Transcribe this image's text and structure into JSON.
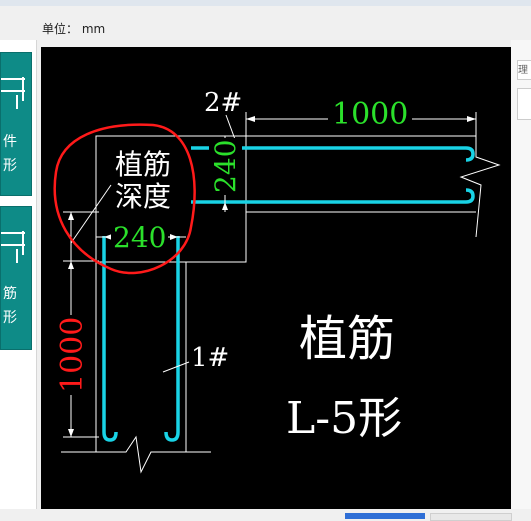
{
  "header": {
    "unit_label": "单位：  mm"
  },
  "left_panel": {
    "thumbs": [
      {
        "label_lines": [
          "件",
          "形"
        ]
      },
      {
        "label_lines": [
          "筋",
          "形"
        ]
      }
    ]
  },
  "right_strip": {
    "tab_label": "理"
  },
  "drawing": {
    "annotation_2": "2#",
    "annotation_1": "1#",
    "dim_top": "1000",
    "dim_vertical_left": "1000",
    "dim_240_inner": "240",
    "dim_240_right": "240",
    "label_depth_line1": "植筋",
    "label_depth_line2": "深度",
    "title_line1": "植筋",
    "title_line2": "L-5形"
  },
  "colors": {
    "canvas_bg": "#000000",
    "rebar": "#19d3e6",
    "dim_text_green": "#2be02b",
    "dim_text_red": "#ff1a1a",
    "line_white": "#ffffff",
    "highlight_circle": "#ff1a1a"
  }
}
